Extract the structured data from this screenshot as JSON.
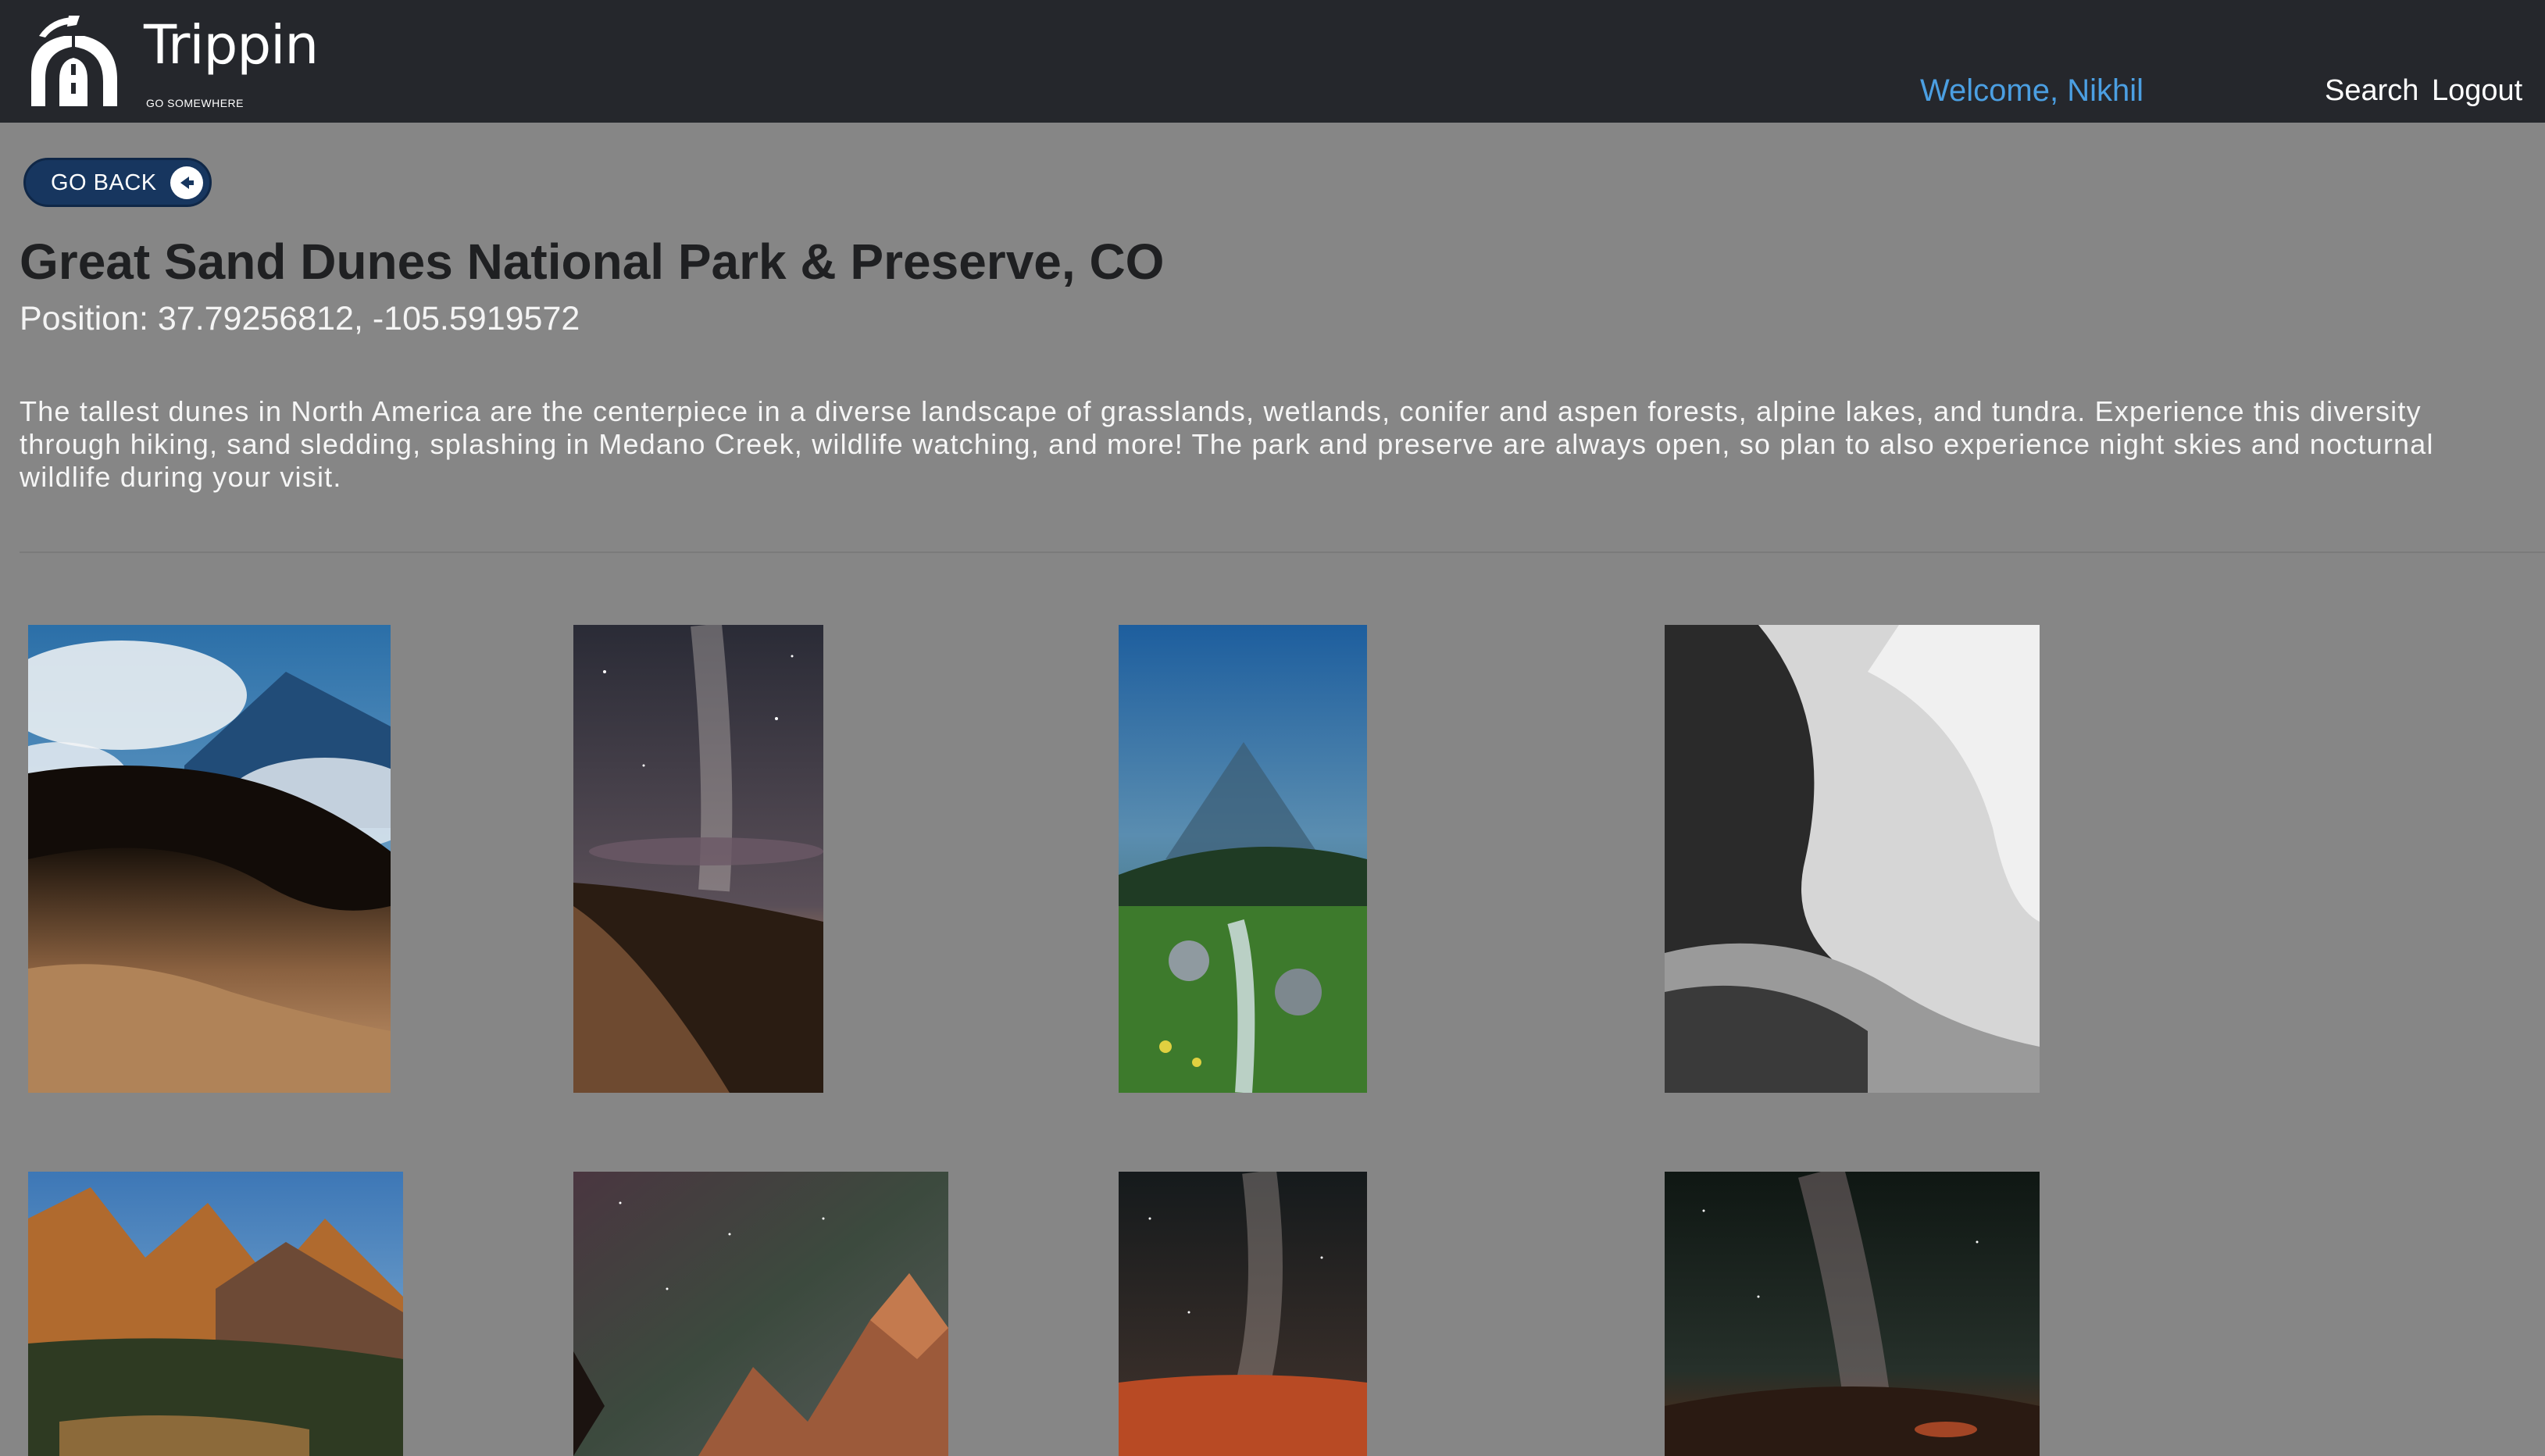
{
  "header": {
    "brand_name": "Trippin",
    "brand_tagline": "GO SOMEWHERE",
    "welcome": "Welcome, Nikhil",
    "nav": {
      "search": "Search",
      "logout": "Logout"
    },
    "colors": {
      "bar": "#25272c",
      "welcome": "#4b9fe2"
    }
  },
  "go_back": {
    "label": "GO BACK",
    "icon": "arrow-left-circle-icon"
  },
  "park": {
    "title": "Great Sand Dunes National Park & Preserve, CO",
    "position": "Position: 37.79256812, -105.5919572",
    "description": "The tallest dunes in North America are the centerpiece in a diverse landscape of grasslands, wetlands, conifer and aspen forests, alpine lakes, and tundra. Experience this diversity through hiking, sand sledding, splashing in Medano Creek, wildlife watching, and more! The park and preserve are always open, so plan to also experience night skies and nocturnal wildlife during your visit."
  },
  "gallery": {
    "rows": 2,
    "photos_per_row": 4
  }
}
